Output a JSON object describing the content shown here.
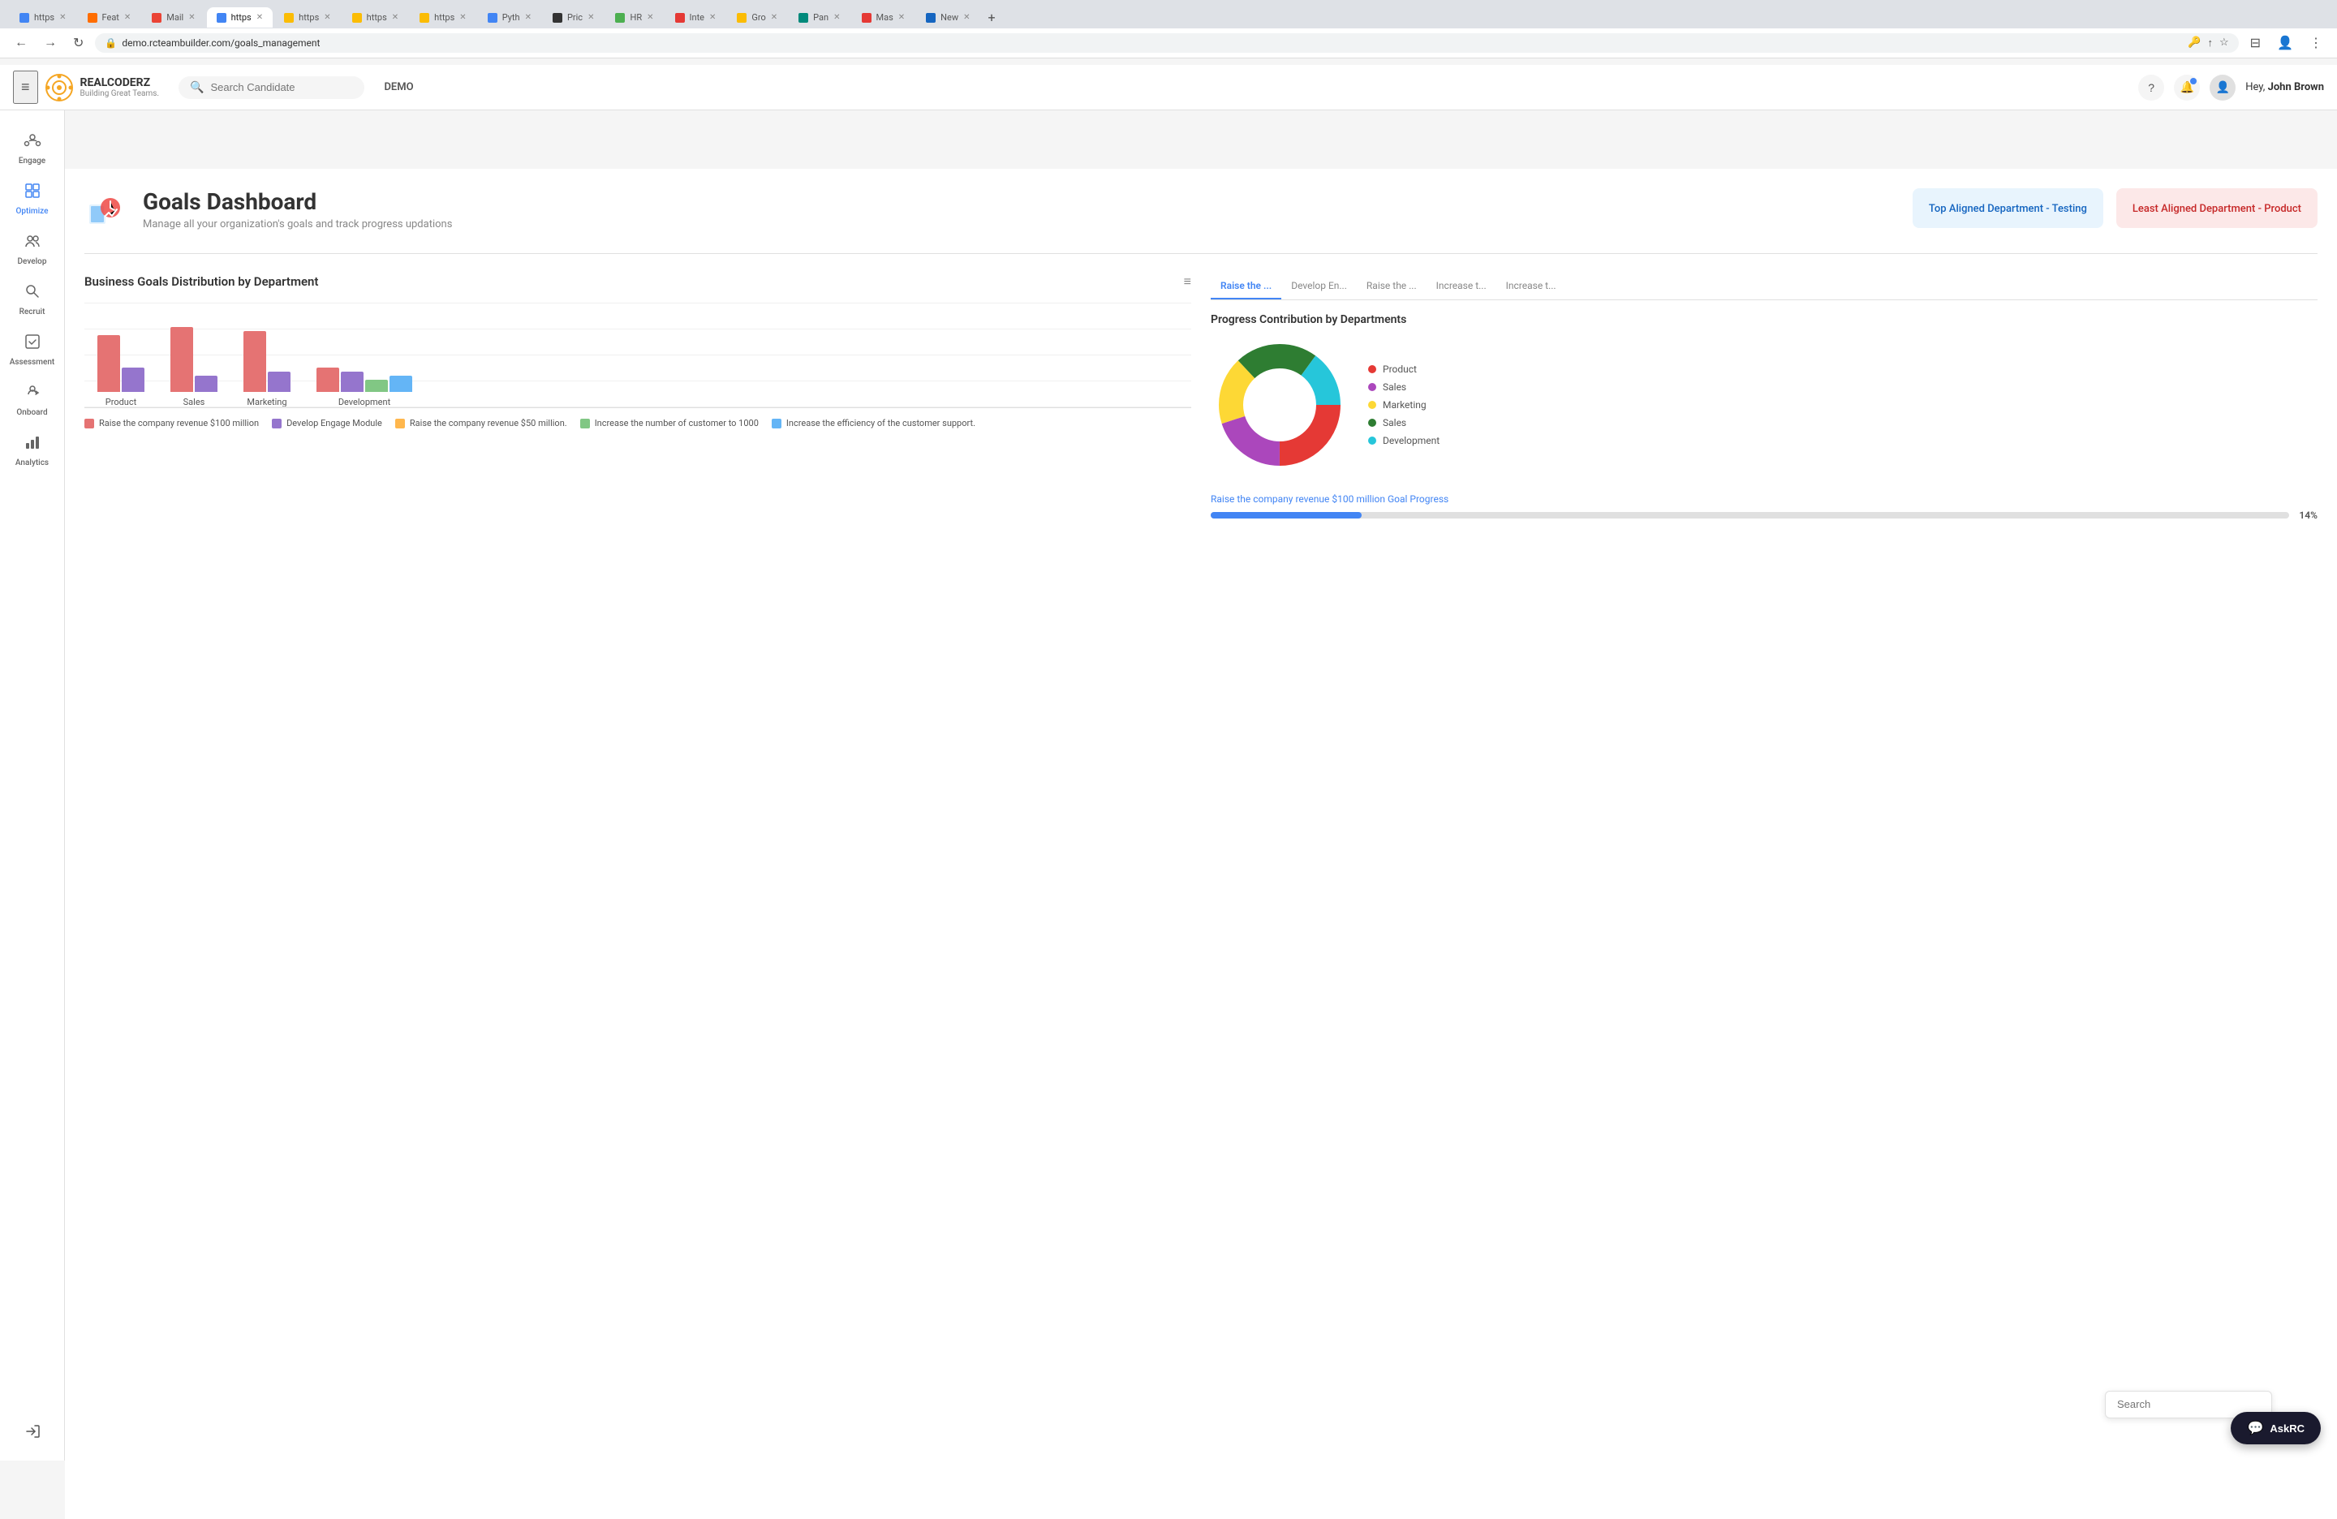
{
  "browser": {
    "url": "demo.rcteambuilder.com/goals_management",
    "tabs": [
      {
        "label": "https",
        "active": false,
        "color": "#4285f4"
      },
      {
        "label": "Feat",
        "active": false,
        "color": "#ff6d00"
      },
      {
        "label": "Mail",
        "active": false,
        "color": "#ea4335"
      },
      {
        "label": "https",
        "active": true,
        "color": "#4285f4"
      },
      {
        "label": "https",
        "active": false,
        "color": "#fbbc04"
      },
      {
        "label": "https",
        "active": false,
        "color": "#fbbc04"
      },
      {
        "label": "https",
        "active": false,
        "color": "#fbbc04"
      },
      {
        "label": "Pyth",
        "active": false,
        "color": "#4285f4"
      },
      {
        "label": "Pric",
        "active": false,
        "color": "#333"
      },
      {
        "label": "HR",
        "active": false,
        "color": "#4caf50"
      },
      {
        "label": "Inte",
        "active": false,
        "color": "#e53935"
      },
      {
        "label": "Gro",
        "active": false,
        "color": "#fbbc04"
      },
      {
        "label": "Pan",
        "active": false,
        "color": "#00897b"
      },
      {
        "label": "Mas",
        "active": false,
        "color": "#e53935"
      },
      {
        "label": "New",
        "active": false,
        "color": "#1565c0"
      }
    ]
  },
  "topnav": {
    "logo_main": "REALCODERZ",
    "logo_sub": "Building Great Teams.",
    "search_placeholder": "Search Candidate",
    "demo_label": "DEMO",
    "greeting": "Hey,",
    "user_name": "John Brown"
  },
  "sidebar": {
    "items": [
      {
        "label": "Engage",
        "icon": "⊕",
        "active": false
      },
      {
        "label": "Optimize",
        "icon": "📋",
        "active": true
      },
      {
        "label": "Develop",
        "icon": "👥",
        "active": false
      },
      {
        "label": "Recruit",
        "icon": "🔍",
        "active": false
      },
      {
        "label": "Assessment",
        "icon": "🤝",
        "active": false
      },
      {
        "label": "Onboard",
        "icon": "🤝",
        "active": false
      },
      {
        "label": "Analytics",
        "icon": "📊",
        "active": false
      }
    ]
  },
  "dashboard": {
    "title": "Goals Dashboard",
    "subtitle": "Manage all your organization's goals and track progress updations",
    "top_dept_label": "Top Aligned Department - Testing",
    "least_dept_label": "Least Aligned Department - Product"
  },
  "bar_chart": {
    "title": "Business Goals Distribution by Department",
    "departments": [
      "Product",
      "Sales",
      "Marketing",
      "Development"
    ],
    "bars": [
      {
        "dept": "Product",
        "pink": 70,
        "purple": 30
      },
      {
        "dept": "Sales",
        "pink": 80,
        "purple": 20
      },
      {
        "dept": "Marketing",
        "pink": 75,
        "purple": 25
      },
      {
        "dept": "Development",
        "pink": 30,
        "purple": 25,
        "green": 15,
        "blue": 20
      }
    ],
    "legend": [
      {
        "color": "#e57373",
        "label": "Raise the company revenue $100 million"
      },
      {
        "color": "#9575cd",
        "label": "Develop Engage Module"
      },
      {
        "color": "#ffb74d",
        "label": "Raise the company revenue $50 million."
      },
      {
        "color": "#81c784",
        "label": "Increase the number of customer to 1000"
      },
      {
        "color": "#64b5f6",
        "label": "Increase the efficiency of the customer support."
      }
    ]
  },
  "goal_tabs": [
    {
      "label": "Raise the ...",
      "active": true
    },
    {
      "label": "Develop En...",
      "active": false
    },
    {
      "label": "Raise the ...",
      "active": false
    },
    {
      "label": "Increase t...",
      "active": false
    },
    {
      "label": "Increase t...",
      "active": false
    }
  ],
  "donut_chart": {
    "title": "Progress Contribution by Departments",
    "segments": [
      {
        "color": "#e53935",
        "pct": 25,
        "label": "Product"
      },
      {
        "color": "#ab47bc",
        "pct": 20,
        "label": "Sales"
      },
      {
        "color": "#fdd835",
        "pct": 18,
        "label": "Marketing"
      },
      {
        "color": "#2e7d32",
        "pct": 22,
        "label": "Sales"
      },
      {
        "color": "#26c6da",
        "pct": 15,
        "label": "Development"
      }
    ]
  },
  "progress": {
    "label": "Raise the company revenue $100 million Goal Progress",
    "pct": 14,
    "pct_label": "14%"
  },
  "bottom": {
    "search_placeholder": "Search",
    "askrc_label": "AskRC"
  }
}
